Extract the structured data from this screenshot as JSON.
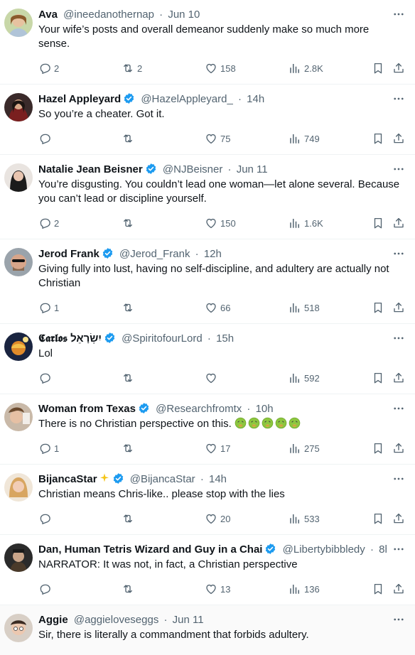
{
  "colors": {
    "text": "#0f1419",
    "muted": "#536471",
    "verified": "#1d9bf0",
    "divider": "#eff3f4"
  },
  "tweets": [
    {
      "name": "Ava",
      "handle": "@ineedanothernap",
      "sep": "·",
      "time": "Jun 10",
      "verified": false,
      "text": "Your wife’s posts and overall demeanor suddenly make so much more sense.",
      "replies": "2",
      "retweets": "2",
      "likes": "158",
      "views": "2.8K"
    },
    {
      "name": "Hazel Appleyard",
      "handle": "@HazelAppleyard_",
      "sep": "·",
      "time": "14h",
      "verified": true,
      "text": "So you’re a cheater. Got it.",
      "replies": "",
      "retweets": "",
      "likes": "75",
      "views": "749"
    },
    {
      "name": "Natalie Jean Beisner",
      "handle": "@NJBeisner",
      "sep": "·",
      "time": "Jun 11",
      "verified": true,
      "text": "You’re disgusting. You couldn’t lead one woman—let alone several. Because you can’t lead or discipline yourself.",
      "replies": "2",
      "retweets": "",
      "likes": "150",
      "views": "1.6K"
    },
    {
      "name": "Jerod Frank",
      "handle": "@Jerod_Frank",
      "sep": "·",
      "time": "12h",
      "verified": true,
      "text": "Giving fully into lust, having no self-discipline, and adultery are actually not Christian",
      "replies": "1",
      "retweets": "",
      "likes": "66",
      "views": "518"
    },
    {
      "name": "𝕮𝖆𝖗𝖑𝖔𝖘 יִשְׂרָאֵל",
      "handle": "@SpiritofourLord",
      "sep": "·",
      "time": "15h",
      "verified": true,
      "text": "Lol",
      "replies": "",
      "retweets": "",
      "likes": "",
      "views": "592"
    },
    {
      "name": "Woman from Texas",
      "handle": "@Researchfromtx",
      "sep": "·",
      "time": "10h",
      "verified": true,
      "text": "There is no Christian perspective on this.",
      "replies": "1",
      "retweets": "",
      "likes": "17",
      "views": "275"
    },
    {
      "name": "BijancaStar",
      "handle": "@BijancaStar",
      "sep": "·",
      "time": "14h",
      "verified": true,
      "text": "Christian means Chris-like.. please stop with the lies",
      "replies": "",
      "retweets": "",
      "likes": "20",
      "views": "533"
    },
    {
      "name": "Dan, Human Tetris Wizard and Guy in a Chai",
      "handle": "@Libertybibbledy",
      "sep": "·",
      "time": "8h",
      "verified": true,
      "text": "NARRATOR:  It was not, in fact, a Christian perspective",
      "replies": "",
      "retweets": "",
      "likes": "13",
      "views": "136"
    },
    {
      "name": "Aggie",
      "handle": "@aggieloveseggs",
      "sep": "·",
      "time": "Jun 11",
      "verified": false,
      "text": "Sir, there is literally a commandment that forbids adultery.",
      "replies": "",
      "retweets": "",
      "likes": "",
      "views": ""
    }
  ]
}
